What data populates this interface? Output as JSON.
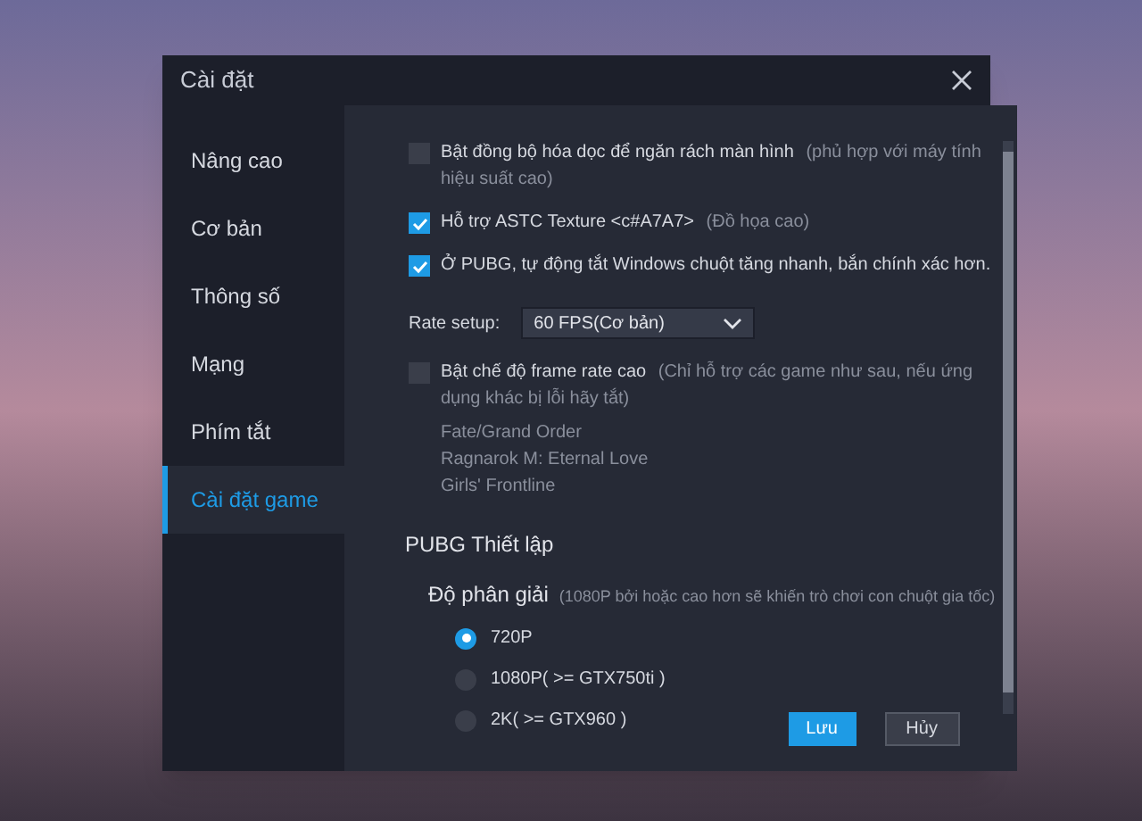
{
  "window": {
    "title": "Cài đặt"
  },
  "sidebar": {
    "items": [
      {
        "label": "Nâng cao",
        "selected": false
      },
      {
        "label": "Cơ bản",
        "selected": false
      },
      {
        "label": "Thông số",
        "selected": false
      },
      {
        "label": "Mạng",
        "selected": false
      },
      {
        "label": "Phím tắt",
        "selected": false
      },
      {
        "label": "Cài đặt game",
        "selected": true
      }
    ]
  },
  "settings": [
    {
      "kind": "checkbox",
      "label": "Bật đồng bộ hóa dọc để ngăn rách màn hình",
      "note": "(phủ hợp với máy tính hiệu suất cao)",
      "checked": false
    },
    {
      "kind": "checkbox",
      "label": "Hỗ trợ ASTC Texture <c#A7A7>",
      "note": "(Đồ họa cao)",
      "checked": true
    },
    {
      "kind": "checkbox",
      "label": "Ở PUBG, tự động tắt Windows chuột tăng nhanh, bắn chính xác hơn.",
      "checked": true
    },
    {
      "kind": "select",
      "label": "Rate setup:",
      "value": "60 FPS(Cơ bản)"
    },
    {
      "kind": "checkbox",
      "label": "Bật chế độ frame rate cao",
      "note": "(Chỉ hỗ trợ các game như sau, nếu ứng dụng khác bị lỗi hãy tắt)",
      "checked": false,
      "games": [
        "Fate/Grand Order",
        "Ragnarok M: Eternal Love",
        "Girls' Frontline"
      ]
    }
  ],
  "pubg": {
    "title": "PUBG Thiết lập",
    "resolution": {
      "label": "Độ phân giải",
      "note": "(1080P bởi hoặc cao hơn sẽ khiến trò chơi con chuột gia tốc)",
      "options": [
        {
          "label": "720P",
          "selected": true
        },
        {
          "label": "1080P( >= GTX750ti )",
          "selected": false
        },
        {
          "label": "2K( >= GTX960 )",
          "selected": false
        }
      ]
    }
  },
  "buttons": [
    {
      "label": "Lưu",
      "kind": "primary"
    },
    {
      "label": "Hủy",
      "kind": "secondary"
    }
  ]
}
